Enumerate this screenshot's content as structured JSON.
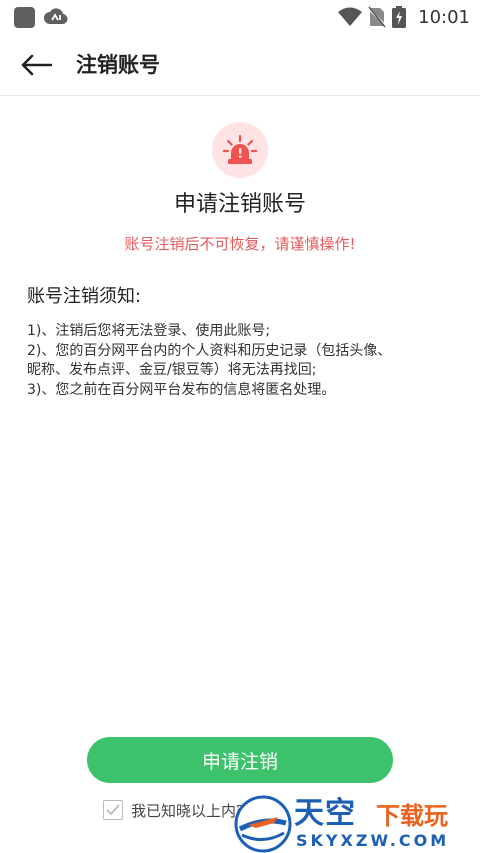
{
  "status_bar": {
    "time": "10:01"
  },
  "header": {
    "title": "注销账号"
  },
  "main": {
    "title": "申请注销账号",
    "warning": "账号注销后不可恢复，请谨慎操作!",
    "notice_heading": "账号注销须知:",
    "notice_lines": [
      "1)、注销后您将无法登录、使用此账号;",
      "2)、您的百分网平台内的个人资料和历史记录（包括头像、",
      "昵称、发布点评、金豆/银豆等）将无法再找回;",
      "3)、您之前在百分网平台发布的信息将匿名处理。"
    ]
  },
  "footer": {
    "apply_button": "申请注销",
    "agree_text": "我已知晓以上内容"
  },
  "watermark": {
    "brand_main": "天空",
    "brand_sub": "下载玩",
    "url": "SKYXZW.COM"
  },
  "colors": {
    "accent_green": "#3cc26a",
    "warning_red": "#e35b5b",
    "alert_bg": "#fde3e3"
  },
  "icons": [
    "back-arrow-icon",
    "alarm-siren-icon",
    "checkbox-check-icon",
    "wifi-icon",
    "no-sim-icon",
    "battery-icon"
  ]
}
